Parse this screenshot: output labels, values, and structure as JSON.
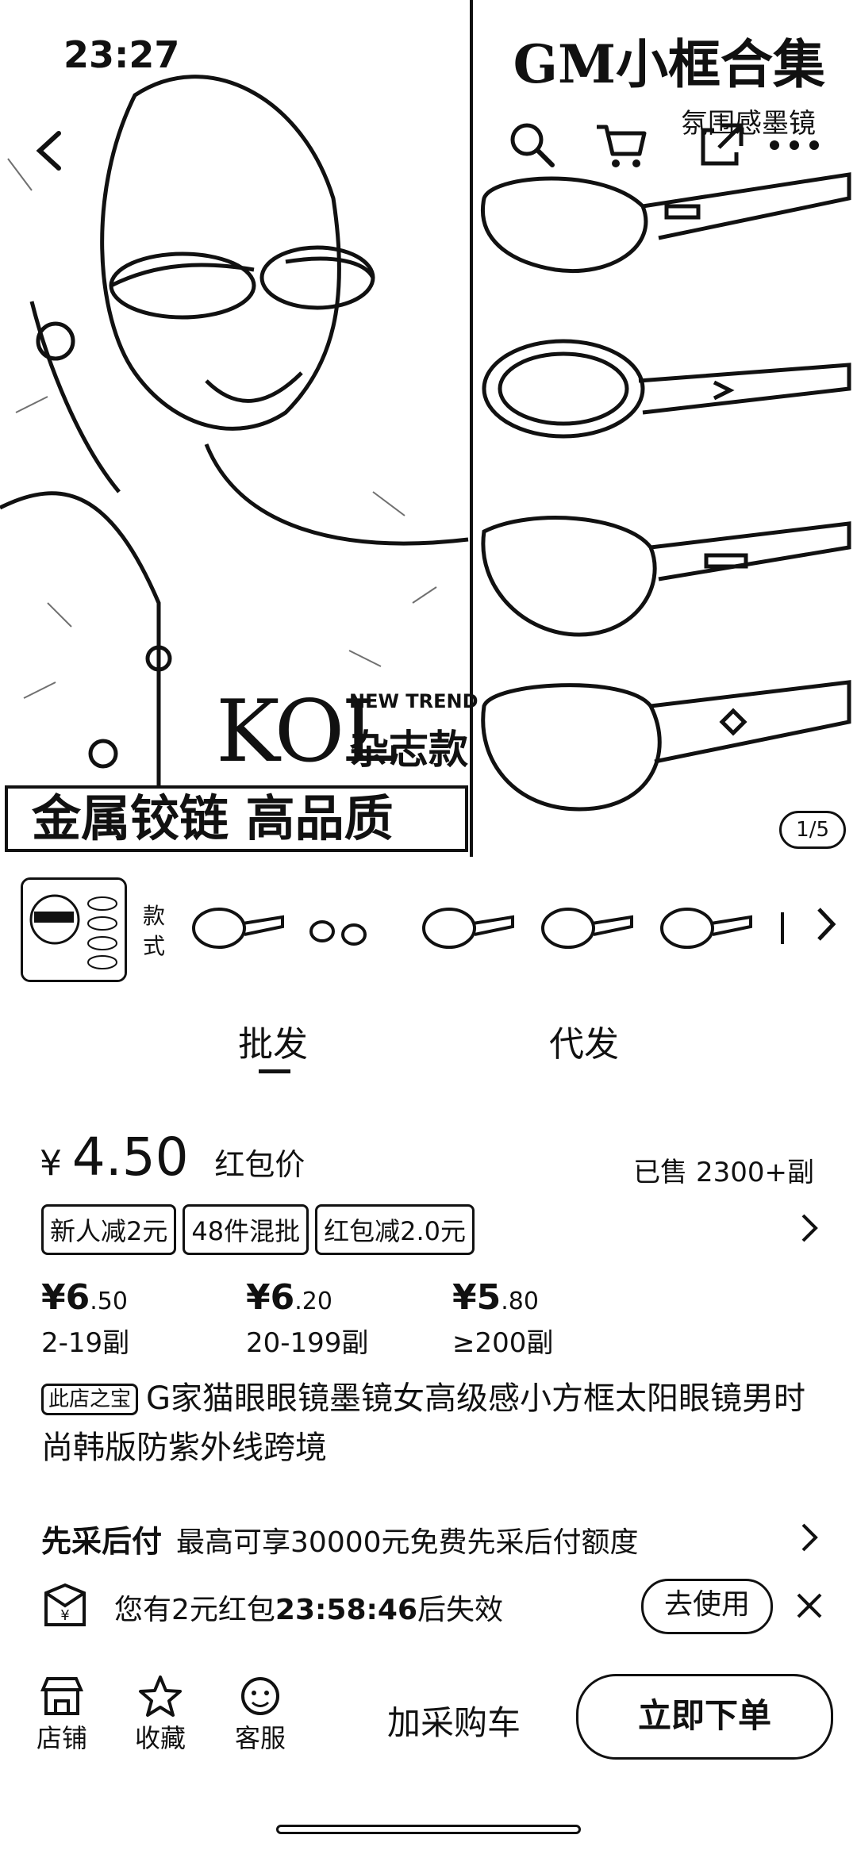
{
  "status": {
    "time": "23:27"
  },
  "hero": {
    "title": "GM小框合集",
    "subtitle": "氛围感墨镜",
    "kol": "KOL",
    "new_trend": "NEW TREND",
    "magazine": "杂志款",
    "banner": "金属铰链  高品质",
    "pager": "1/5"
  },
  "styles": {
    "label": "款式"
  },
  "tabs": [
    {
      "label": "批发"
    },
    {
      "label": "代发"
    }
  ],
  "price": {
    "currency": "¥",
    "main": "4.50",
    "note": "红包价",
    "sold": "已售 2300+副"
  },
  "tags": [
    "新人减2元",
    "48件混批",
    "红包减2.0元"
  ],
  "tiers": [
    {
      "price_int": "¥6",
      "price_dec": ".50",
      "qty": "2-19副"
    },
    {
      "price_int": "¥6",
      "price_dec": ".20",
      "qty": "20-199副"
    },
    {
      "price_int": "¥5",
      "price_dec": ".80",
      "qty": "≥200副"
    }
  ],
  "product": {
    "shop_badge": "此店之宝",
    "title": "G家猫眼眼镜墨镜女高级感小方框太阳眼镜男时尚韩版防紫外线跨境"
  },
  "paylater": {
    "label": "先采后付",
    "text": "最高可享30000元免费先采后付额度"
  },
  "coupon": {
    "text_prefix": "您有2元红包",
    "countdown": "23:58:46",
    "text_suffix": "后失效",
    "use_label": "去使用"
  },
  "bottom": {
    "shop": "店铺",
    "favorite": "收藏",
    "service": "客服",
    "add_cart": "加采购车",
    "buy_now": "立即下单"
  },
  "icons": [
    "back-icon",
    "search-icon",
    "cart-icon",
    "share-icon",
    "more-icon",
    "chevron-right-icon",
    "close-icon",
    "shop-icon",
    "star-icon",
    "chat-icon",
    "red-packet-icon"
  ]
}
